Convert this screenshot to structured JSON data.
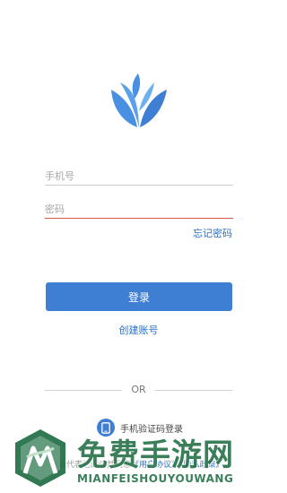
{
  "form": {
    "phone_placeholder": "手机号",
    "password_placeholder": "密码",
    "forgot_password": "忘记密码"
  },
  "actions": {
    "login_label": "登录",
    "create_account": "创建账号",
    "or_label": "OR",
    "sms_login": "手机验证码登录"
  },
  "agreement": {
    "text": "登录代表已阅读并同意",
    "user_agreement": "《用户协议》",
    "privacy_policy": "《隐私政策》"
  },
  "watermark": {
    "title": "免费手游网",
    "subtitle": "MIANFEISHOUYOUWANG"
  },
  "colors": {
    "accent": "#3f7fd3",
    "link": "#2f6fbd",
    "error_underline": "#d9534f",
    "watermark": "#1f6e43"
  }
}
